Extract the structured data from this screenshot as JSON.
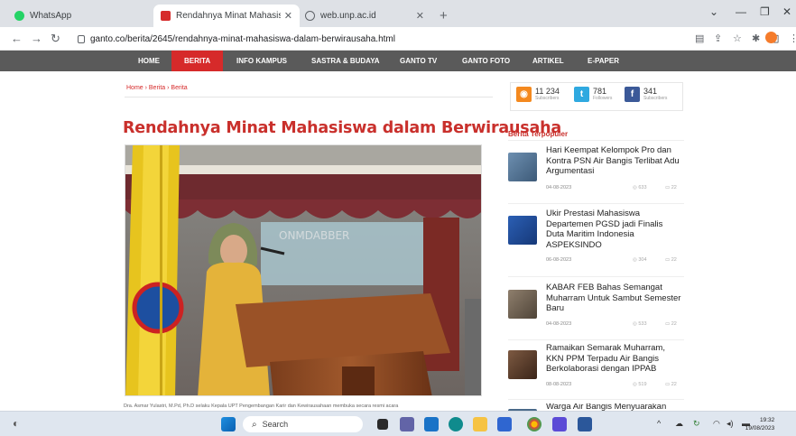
{
  "browser": {
    "tabs": [
      {
        "title": "WhatsApp",
        "favicon_color": "#25d366"
      },
      {
        "title": "Rendahnya Minat Mahasiswa dal",
        "favicon_color": "#d62a2a",
        "active": true
      },
      {
        "title": "web.unp.ac.id",
        "favicon_color": "#5f6368"
      }
    ],
    "url": "ganto.co/berita/2645/rendahnya-minat-mahasiswa-dalam-berwirausaha.html"
  },
  "site_nav": [
    "HOME",
    "BERITA",
    "INFO KAMPUS",
    "SASTRA & BUDAYA",
    "GANTO TV",
    "GANTO FOTO",
    "ARTIKEL",
    "E-PAPER"
  ],
  "breadcrumb": "Home › Berita › Berita",
  "article": {
    "title": "Rendahnya Minat Mahasiswa dalam Berwirausaha",
    "photo_watermark": "ONMDABBER",
    "caption": "Dra. Asmar Yulastri, M.Pd, Ph.D selaku Kepala UPT Pengembangan Karir dan Kewirausahaan membuka secara resmi acara"
  },
  "social": [
    {
      "count": "11 234",
      "label": "Subscribers",
      "icon": "rss-icon",
      "color": "#f4891f"
    },
    {
      "count": "781",
      "label": "Followers",
      "icon": "twitter-icon",
      "color": "#2fa9e0"
    },
    {
      "count": "341",
      "label": "Subscribers",
      "icon": "facebook-icon",
      "color": "#3b5998"
    }
  ],
  "popular": {
    "title": "Berita Terpopuler",
    "items": [
      {
        "title": "Hari Keempat Kelompok Pro dan Kontra PSN Air Bangis Terlibat Adu Argumentasi",
        "date": "04-08-2023",
        "views": "633",
        "comments": "22",
        "thumb_color": "#5d7fa3"
      },
      {
        "title": "Ukir Prestasi Mahasiswa Departemen PGSD jadi Finalis Duta Maritim Indonesia ASPEKSINDO",
        "date": "06-08-2023",
        "views": "304",
        "comments": "22",
        "thumb_color": "#1f4f9b"
      },
      {
        "title": "KABAR FEB Bahas Semangat Muharram Untuk Sambut Semester Baru",
        "date": "04-08-2023",
        "views": "533",
        "comments": "22",
        "thumb_color": "#7a6a5a"
      },
      {
        "title": "Ramaikan Semarak Muharram, KKN PPM Terpadu Air Bangis Berkolaborasi dengan IPPAB",
        "date": "08-08-2023",
        "views": "519",
        "comments": "22",
        "thumb_color": "#6b4a3a"
      },
      {
        "title": "Warga Air Bangis Menyuarakan",
        "date": "",
        "views": "",
        "comments": "",
        "thumb_color": "#4a6a8a"
      }
    ]
  },
  "taskbar": {
    "search_placeholder": "Search",
    "time": "19:32",
    "date": "19/08/2023"
  },
  "colors": {
    "accent": "#c9302c",
    "nav_bg": "#5a5a5a"
  }
}
